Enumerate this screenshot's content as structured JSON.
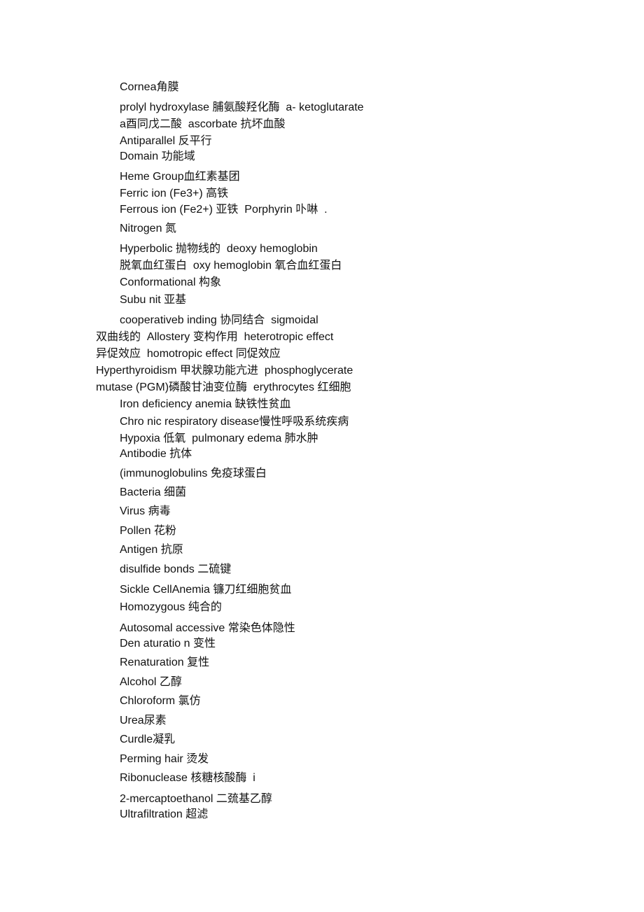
{
  "document": {
    "lines": [
      "Cornea角膜",
      "prolyl hydroxylase 脯氨酸羟化酶  a- ketoglutarate",
      "a酉同戊二酸  ascorbate 抗坏血酸",
      "Antiparallel 反平行",
      "Domain 功能域",
      "Heme Group血红素基团",
      "Ferric ion (Fe3+) 高铁",
      "Ferrous ion (Fe2+) 亚铁  Porphyrin 卟啉  .",
      "Nitrogen 氮",
      "Hyperbolic 抛物线的  deoxy hemoglobin",
      "脱氧血红蛋白  oxy hemoglobin 氧合血红蛋白",
      "Conformational 构象",
      "Subu nit 亚基",
      "cooperativeb inding 协同结合  sigmoidal",
      "双曲线的  Allostery 变构作用  heterotropic effect",
      "异促效应  homotropic effect 同促效应",
      "Hyperthyroidism 甲状腺功能亢进  phosphoglycerate",
      "mutase (PGM)磷酸甘油变位酶  erythrocytes 红细胞",
      "Iron deficiency anemia 缺铁性贫血",
      "Chro nic respiratory disease慢性呼吸系统疾病",
      "Hypoxia 低氧  pulmonary edema 肺水肿",
      "Antibodie 抗体",
      "(immunoglobulins 免疫球蛋白",
      "Bacteria 细菌",
      "Virus 病毒",
      "Pollen 花粉",
      "Antigen 抗原",
      "disulfide bonds 二硫键",
      "Sickle CellAnemia 镰刀红细胞贫血",
      "Homozygous 纯合的",
      "Autosomal accessive 常染色体隐性",
      "Den aturatio n 变性",
      "Renaturation 复性",
      "Alcohol 乙醇",
      "Chloroform 氯仿",
      "Urea尿素",
      "Curdle凝乳",
      "Perming hair 烫发",
      "Ribonuclease 核糖核酸酶  i",
      "2-mercaptoethanol 二巯基乙醇",
      "Ultrafiltration 超滤"
    ]
  }
}
